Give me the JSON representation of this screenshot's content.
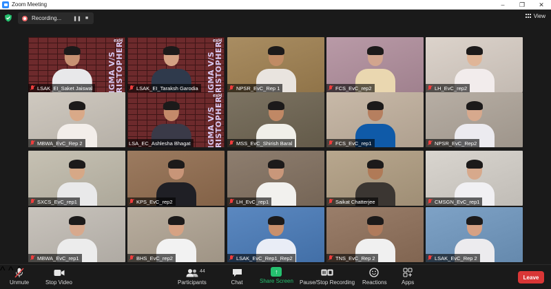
{
  "window": {
    "title": "Zoom Meeting"
  },
  "topbar": {
    "recording_label": "Recording...",
    "view_label": "View"
  },
  "branding": {
    "banner_text": "ENIGMA V/S CHRISTOPHER",
    "logo_text": "exH"
  },
  "participants": [
    {
      "name": "LSAK_EI_Saket Jaiswal",
      "bg": "brick",
      "skin": "#c89273",
      "shirt": "#e8e8ea"
    },
    {
      "name": "LSAK_EI_Taraksh Garodia",
      "bg": "brick",
      "skin": "#d4a284",
      "shirt": "#2f3a4c"
    },
    {
      "name": "NPSR_EvC_Rep 1",
      "bg": "#a98d62",
      "skin": "#c08b64",
      "shirt": "#e9e4df"
    },
    {
      "name": "FCS_EvC_rep2",
      "bg": "#b99aa7",
      "skin": "#d2a58e",
      "shirt": "#ead7b0"
    },
    {
      "name": "LH_EvC_rep2",
      "bg": "#dcd3cb",
      "skin": "#e0b597",
      "shirt": "#f2ecec"
    },
    {
      "name": "MBWA_EvC_Rep 2",
      "bg": "#cfc9c0",
      "skin": "#d9a988",
      "shirt": "#f3eeea"
    },
    {
      "name": "LSA_EC_Ashlesha Bhagat",
      "bg": "brick",
      "skin": "#c48a6a",
      "shirt": "#3a3a48",
      "active": true
    },
    {
      "name": "MSS_EvC_Shirish Baral",
      "bg": "#7c7362",
      "skin": "#c08865",
      "shirt": "#f0efe9"
    },
    {
      "name": "FCS_EvC_rep1",
      "bg": "#c8b9a8",
      "skin": "#b67f5f",
      "shirt": "#0f5aa8"
    },
    {
      "name": "NPSR_EvC_Rep2",
      "bg": "#b7aea4",
      "skin": "#d7a98d",
      "shirt": "#ecebf0"
    },
    {
      "name": "SXCS_EvC_rep1",
      "bg": "#c6c1b3",
      "skin": "#d6a887",
      "shirt": "#e9e9ea"
    },
    {
      "name": "KPS_EvC_rep2",
      "bg": "#9c7b60",
      "skin": "#c89578",
      "shirt": "#1f1f25"
    },
    {
      "name": "LH_EvC_rep1",
      "bg": "#8e7e6f",
      "skin": "#c9977a",
      "shirt": "#f2f1ee"
    },
    {
      "name": "Saikat Chatterjee",
      "bg": "#b8a78e",
      "skin": "#b07a57",
      "shirt": "#3b3632"
    },
    {
      "name": "CMSGN_EvC_rep1",
      "bg": "#d9d5cf",
      "skin": "#d7a98c",
      "shirt": "#f1f0f3"
    },
    {
      "name": "MBWA_EvC_rep1",
      "bg": "#c8c3bc",
      "skin": "#d8a98d",
      "shirt": "#ececec"
    },
    {
      "name": "BHS_EvC_rep2",
      "bg": "#b8ad9e",
      "skin": "#d6a283",
      "shirt": "#f2f2f2"
    },
    {
      "name": "LSAK_EvC_Rep1_Rep2",
      "bg": "#5b88c0",
      "skin": "#c9906c",
      "shirt": "#e9edf6"
    },
    {
      "name": "TNS_EvC_Rep 2",
      "bg": "#9a7e6a",
      "skin": "#b07b5c",
      "shirt": "#f0f0f0"
    },
    {
      "name": "LSAK_EvC_Rep 2",
      "bg": "#7ea2c6",
      "skin": "#d6a184",
      "shirt": "#ecebee"
    }
  ],
  "toolbar": {
    "unmute_label": "Unmute",
    "stop_video_label": "Stop Video",
    "participants_label": "Participants",
    "participants_count": "44",
    "chat_label": "Chat",
    "share_label": "Share Screen",
    "pause_rec_label": "Pause/Stop Recording",
    "reactions_label": "Reactions",
    "apps_label": "Apps",
    "leave_label": "Leave"
  },
  "colors": {
    "accent_green": "#25c16f",
    "leave_red": "#d93636",
    "active_speaker": "#f2e463"
  }
}
